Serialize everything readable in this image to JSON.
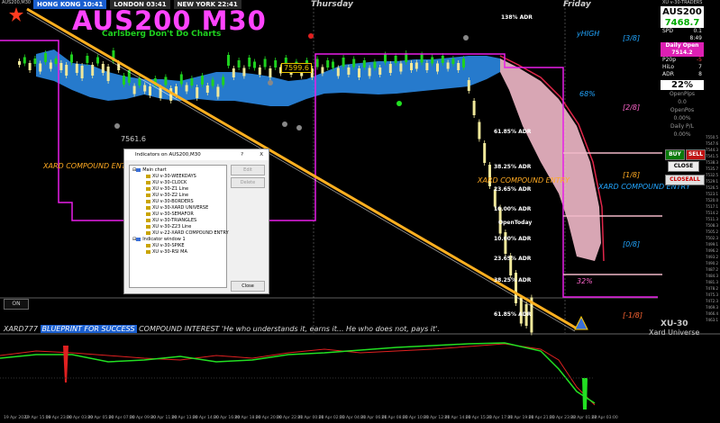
{
  "window": {
    "title": "AUS200,M30"
  },
  "sessions": [
    {
      "name": "HONG KONG",
      "time": "10:41"
    },
    {
      "name": "LONDON",
      "time": "03:41"
    },
    {
      "name": "NEW YORK",
      "time": "22:41"
    }
  ],
  "chart_title": "AUS200 M30",
  "chart_subtitle": "Carlsberg Don't Do Charts",
  "days": {
    "thursday": "Thursday",
    "friday": "Friday"
  },
  "price_labels": {
    "high_box": "7599.6",
    "low_text": "7561.6"
  },
  "fib_labels": {
    "f138": "138% ADR",
    "f6185a": "61.85% ADR",
    "f3825": "38.25% ADR",
    "f2365a": "23.65% ADR",
    "f10a": "10.00% ADR",
    "open_today": "OpenToday",
    "f10b": "10.00% ADR",
    "f2365b": "23.65% ADR",
    "f3825b": "38.25% ADR",
    "f6185b": "61.85% ADR"
  },
  "octaves": {
    "yhigh": "yHIGH",
    "o38": "[3/8]",
    "p68": "68%",
    "o28": "[2/8]",
    "o18": "[1/8]",
    "o08": "[0/8]",
    "om18": "[-1/8]",
    "p32": "32%"
  },
  "xard_entry_left": "XARD COMPOUND ENTRY",
  "xard_entry_mid": "XARD COMPOUND ENTRY",
  "xard_entry_right": "XARD COMPOUND ENTRY",
  "on_button": "ON",
  "ticker": {
    "prefix": "XARD777",
    "highlight": "BLUEPRINT FOR SUCCESS",
    "text": "COMPOUND INTEREST  'He who understands it, earns it... He who does not, pays it'."
  },
  "brand": {
    "xu": "XU-30",
    "universe": "Xard Universe"
  },
  "top_right_label": "XU v-30-TRADERS",
  "right_panel": {
    "symbol": "AUS200",
    "price": "7468.7",
    "rows": [
      {
        "k": "SPD",
        "v": "0.1"
      },
      {
        "k": "",
        "v": "8:49"
      }
    ],
    "daily_open_label": "Daily Open",
    "daily_open": "7514.2",
    "stats": [
      {
        "k": "P20p",
        "v": "-5"
      },
      {
        "k": "HiLo",
        "v": "7"
      },
      {
        "k": "ADR",
        "v": "8"
      }
    ],
    "pct": "22%",
    "open_pips_label": "OpenPips",
    "open_pips": "0.0",
    "open_pos_label": "OpenPos",
    "open_pos": "0.00%",
    "daily_pl_label": "Daily P/L",
    "daily_pl": "0.00%"
  },
  "trade_buttons": {
    "buy": "BUY",
    "sell": "SELL",
    "close": "CLOSE",
    "closeall": "CLOSEALL"
  },
  "price_axis": [
    "7550.5",
    "7547.6",
    "7544.3",
    "7541.5",
    "7538.3",
    "7535.7",
    "7532.5",
    "7529.1",
    "7526.5",
    "7523.1",
    "7520.0",
    "7517.1",
    "7514.2",
    "7511.3",
    "7508.3",
    "7505.2",
    "7502.3",
    "7499.1",
    "7496.2",
    "7493.2",
    "7490.2",
    "7487.2",
    "7484.3",
    "7481.3",
    "7478.2",
    "7475.3",
    "7472.3",
    "7469.3",
    "7466.4",
    "7463.1"
  ],
  "time_axis": [
    "19 Apr 2022",
    "19 Apr 15:00",
    "19 Apr 23:00",
    "20 Apr 03:00",
    "20 Apr 05:00",
    "20 Apr 07:00",
    "20 Apr 09:00",
    "20 Apr 11:00",
    "20 Apr 13:00",
    "20 Apr 14:00",
    "20 Apr 16:00",
    "20 Apr 18:00",
    "20 Apr 20:00",
    "20 Apr 22:00",
    "21 Apr 00:00",
    "21 Apr 02:00",
    "21 Apr 04:00",
    "21 Apr 06:00",
    "21 Apr 08:00",
    "21 Apr 10:00",
    "21 Apr 12:00",
    "21 Apr 14:00",
    "21 Apr 15:30",
    "21 Apr 17:00",
    "21 Apr 19:00",
    "21 Apr 21:00",
    "21 Apr 23:00",
    "22 Apr 01:00",
    "22 Apr 03:00"
  ],
  "dialog": {
    "title": "Indicators on AUS200,M30",
    "help": "?",
    "close_x": "X",
    "main_chart": "Main chart",
    "main_items": [
      "XU v-30-WEEKDAYS",
      "XU v-30-CLOCK",
      "XU v-30-Z1 Line",
      "XU v-30-Z2 Line",
      "XU v-30-BORDERS",
      "XU v-30-XARD UNIVERSE",
      "XU v-30-SEMAFOR",
      "XU v-30-TRIANGLES",
      "XU v-30-Z23 Line",
      "XU v-22-XARD COMPOUND ENTRY"
    ],
    "window1": "Indicator window 1",
    "window1_items": [
      "XU v-30-SPIKE",
      "XU v-30-RSI MA"
    ],
    "edit": "Edit",
    "delete": "Delete",
    "close": "Close"
  },
  "colors": {
    "magenta_line": "#e81ee8",
    "orange_line": "#ffb020",
    "cloud_blue": "#2d8ff0",
    "cloud_pink": "#f0b8c8",
    "bull_candle": "#1fd11f",
    "bear_candle": "#f0e89a",
    "rsi_green": "#22e022",
    "rsi_red": "#e02020"
  }
}
